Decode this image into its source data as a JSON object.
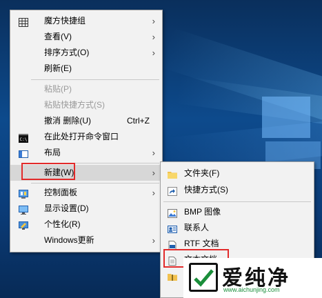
{
  "colors": {
    "menu_bg": "#f2f2f2",
    "highlight": "#d7d7d7",
    "annotation_red": "#e22a2a",
    "watermark_green": "#1a8e3a"
  },
  "context_menu": {
    "items": [
      {
        "label": "魔方快捷组",
        "icon": "grid-icon",
        "submenu": true
      },
      {
        "label": "查看(V)",
        "submenu": true
      },
      {
        "label": "排序方式(O)",
        "submenu": true
      },
      {
        "label": "刷新(E)"
      },
      {
        "label": "粘贴(P)",
        "disabled": true
      },
      {
        "label": "粘贴快捷方式(S)",
        "disabled": true
      },
      {
        "label": "撤消 删除(U)",
        "accelerator": "Ctrl+Z"
      },
      {
        "label": "在此处打开命令窗口",
        "icon": "command-prompt-icon"
      },
      {
        "label": "布局",
        "icon": "layout-icon",
        "submenu": true
      },
      {
        "label": "新建(W)",
        "submenu": true,
        "highlighted": true
      },
      {
        "label": "控制面板",
        "icon": "control-panel-icon",
        "submenu": true
      },
      {
        "label": "显示设置(D)",
        "icon": "display-icon"
      },
      {
        "label": "个性化(R)",
        "icon": "personalize-icon"
      },
      {
        "label": "Windows更新",
        "submenu": true
      }
    ]
  },
  "new_submenu": {
    "items": [
      {
        "label": "文件夹(F)",
        "icon": "folder-icon"
      },
      {
        "label": "快捷方式(S)",
        "icon": "shortcut-icon"
      },
      {
        "label": "BMP 图像",
        "icon": "bmp-image-icon"
      },
      {
        "label": "联系人",
        "icon": "contact-icon"
      },
      {
        "label": "RTF 文档",
        "icon": "rtf-document-icon"
      },
      {
        "label": "文本文档",
        "icon": "text-document-icon"
      }
    ]
  },
  "watermark": {
    "title": "爱纯净",
    "url": "www.aichunjing.com"
  }
}
